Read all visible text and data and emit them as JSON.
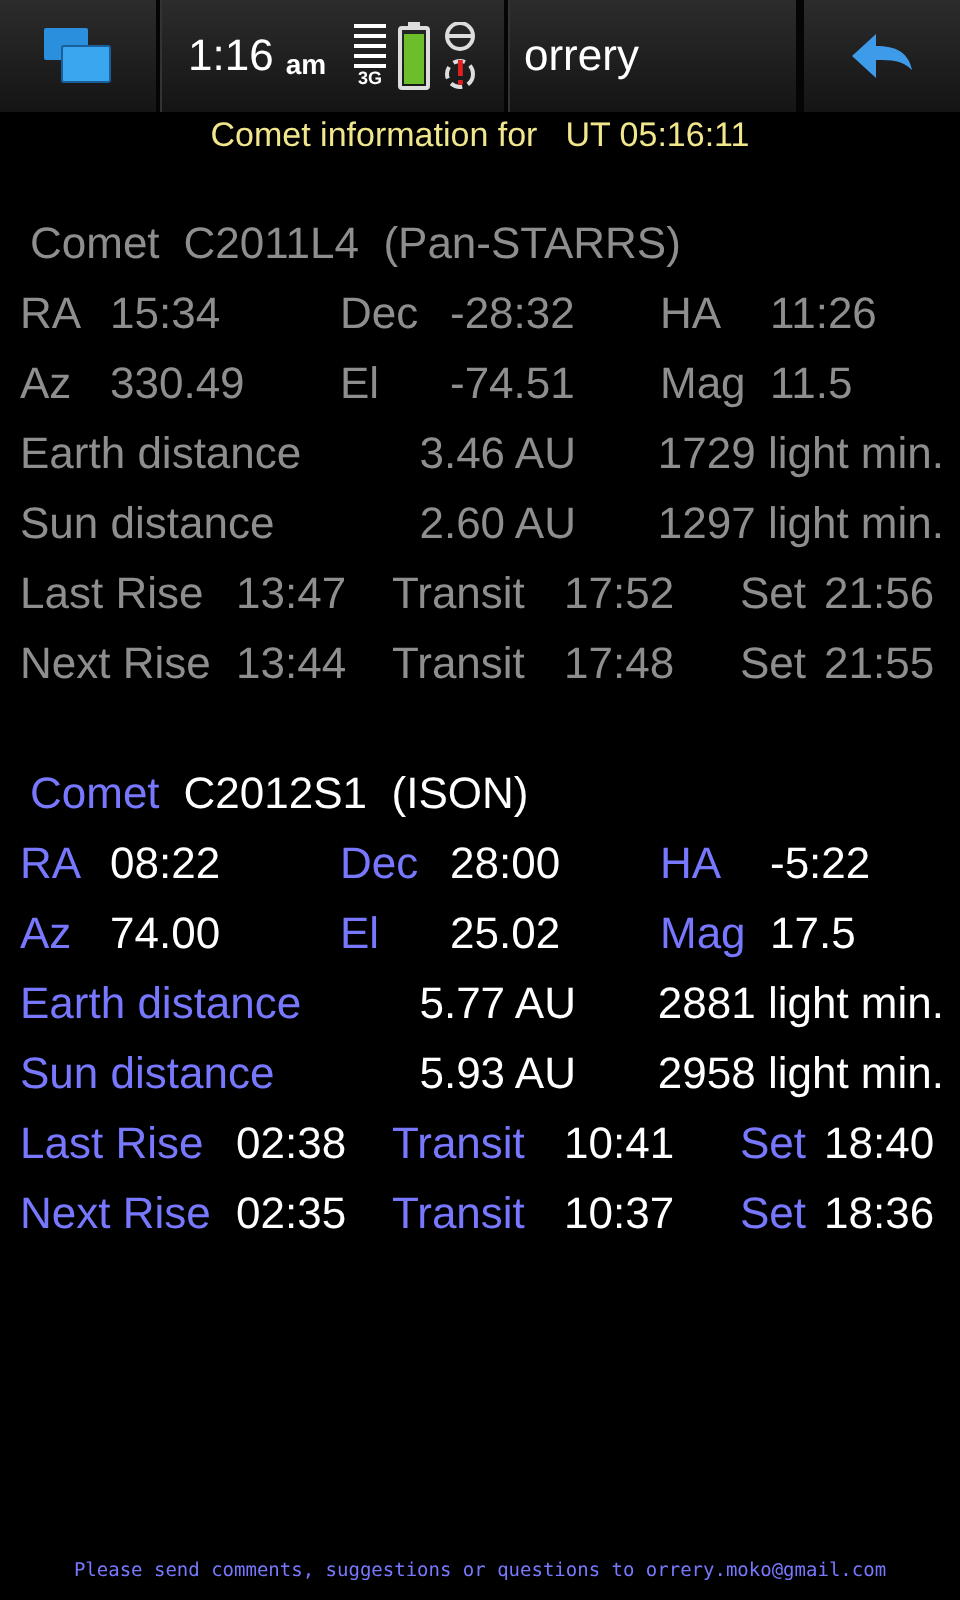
{
  "top_bar": {
    "time": "1:16",
    "ampm": "am",
    "network": "3G",
    "title": "orrery"
  },
  "subtitle": {
    "label": "Comet information for",
    "time": "UT 05:16:11"
  },
  "comets": [
    {
      "selected": false,
      "label": "Comet",
      "name": "C2011L4  (Pan-STARRS)",
      "rows": [
        {
          "kind": "coords",
          "cells": [
            "RA",
            "15:34",
            "Dec",
            "-28:32",
            "HA",
            "11:26"
          ]
        },
        {
          "kind": "coords",
          "cells": [
            "Az",
            "330.49",
            "El",
            "-74.51",
            "Mag",
            "11.5"
          ]
        },
        {
          "kind": "distance",
          "cells": [
            "Earth distance",
            "3.46 AU",
            "1729 light min."
          ]
        },
        {
          "kind": "distance",
          "cells": [
            "Sun distance",
            "2.60 AU",
            "1297 light min."
          ]
        },
        {
          "kind": "times",
          "cells": [
            "Last Rise",
            "13:47",
            "Transit",
            "17:52",
            "Set",
            "21:56"
          ]
        },
        {
          "kind": "times",
          "cells": [
            "Next Rise",
            "13:44",
            "Transit",
            "17:48",
            "Set",
            "21:55"
          ]
        }
      ]
    },
    {
      "selected": true,
      "label": "Comet",
      "name": "C2012S1  (ISON)",
      "rows": [
        {
          "kind": "coords",
          "cells": [
            "RA",
            "08:22",
            "Dec",
            "28:00",
            "HA",
            "-5:22"
          ]
        },
        {
          "kind": "coords",
          "cells": [
            "Az",
            "74.00",
            "El",
            "25.02",
            "Mag",
            "17.5"
          ]
        },
        {
          "kind": "distance",
          "cells": [
            "Earth distance",
            "5.77 AU",
            "2881 light min."
          ]
        },
        {
          "kind": "distance",
          "cells": [
            "Sun distance",
            "5.93 AU",
            "2958 light min."
          ]
        },
        {
          "kind": "times",
          "cells": [
            "Last Rise",
            "02:38",
            "Transit",
            "10:41",
            "Set",
            "18:40"
          ]
        },
        {
          "kind": "times",
          "cells": [
            "Next Rise",
            "02:35",
            "Transit",
            "10:37",
            "Set",
            "18:36"
          ]
        }
      ]
    }
  ],
  "footer": "Please send comments, suggestions or questions to orrery.moko@gmail.com"
}
